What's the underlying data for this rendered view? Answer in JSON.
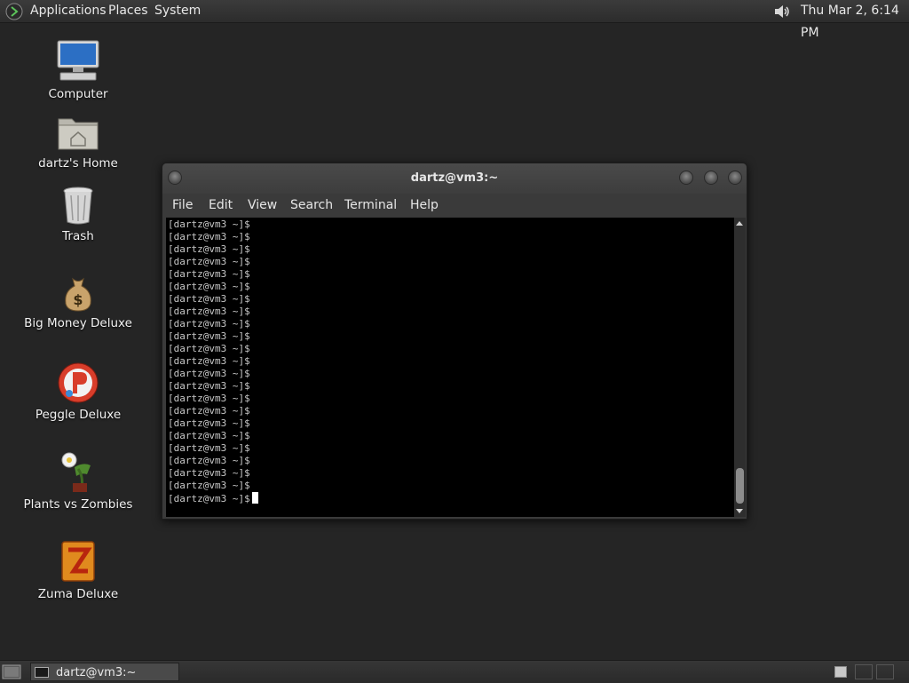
{
  "top_panel": {
    "menus": [
      "Applications",
      "Places",
      "System"
    ],
    "clock": "Thu Mar  2,  6:14 PM",
    "icons": [
      "gnome-foot-icon",
      "volume-icon"
    ]
  },
  "desktop": {
    "icons": [
      {
        "label": "Computer",
        "icon": "computer-icon"
      },
      {
        "label": "dartz's Home",
        "icon": "home-folder-icon"
      },
      {
        "label": "Trash",
        "icon": "trash-icon"
      },
      {
        "label": "Big Money Deluxe",
        "icon": "money-bag-icon"
      },
      {
        "label": "Peggle Deluxe",
        "icon": "peggle-icon"
      },
      {
        "label": "Plants vs Zombies",
        "icon": "plants-vs-zombies-icon"
      },
      {
        "label": "Zuma Deluxe",
        "icon": "zuma-icon"
      }
    ]
  },
  "terminal": {
    "title": "dartz@vm3:~",
    "menu": [
      "File",
      "Edit",
      "View",
      "Search",
      "Terminal",
      "Help"
    ],
    "lines": [
      "[dartz@vm3 ~]$",
      "[dartz@vm3 ~]$",
      "[dartz@vm3 ~]$",
      "[dartz@vm3 ~]$",
      "[dartz@vm3 ~]$",
      "[dartz@vm3 ~]$",
      "[dartz@vm3 ~]$",
      "[dartz@vm3 ~]$",
      "[dartz@vm3 ~]$",
      "[dartz@vm3 ~]$",
      "[dartz@vm3 ~]$",
      "[dartz@vm3 ~]$",
      "[dartz@vm3 ~]$",
      "[dartz@vm3 ~]$",
      "[dartz@vm3 ~]$",
      "[dartz@vm3 ~]$",
      "[dartz@vm3 ~]$",
      "[dartz@vm3 ~]$",
      "[dartz@vm3 ~]$",
      "[dartz@vm3 ~]$",
      "[dartz@vm3 ~]$",
      "[dartz@vm3 ~]$",
      "[dartz@vm3 ~]$"
    ],
    "colors": {
      "background": "#000000",
      "text": "#c8c8c8",
      "cursor": "#ffffff"
    }
  },
  "bottom_panel": {
    "task_label": "dartz@vm3:~",
    "workspaces": [
      {
        "active": true
      },
      {
        "active": false
      },
      {
        "active": false
      }
    ]
  }
}
